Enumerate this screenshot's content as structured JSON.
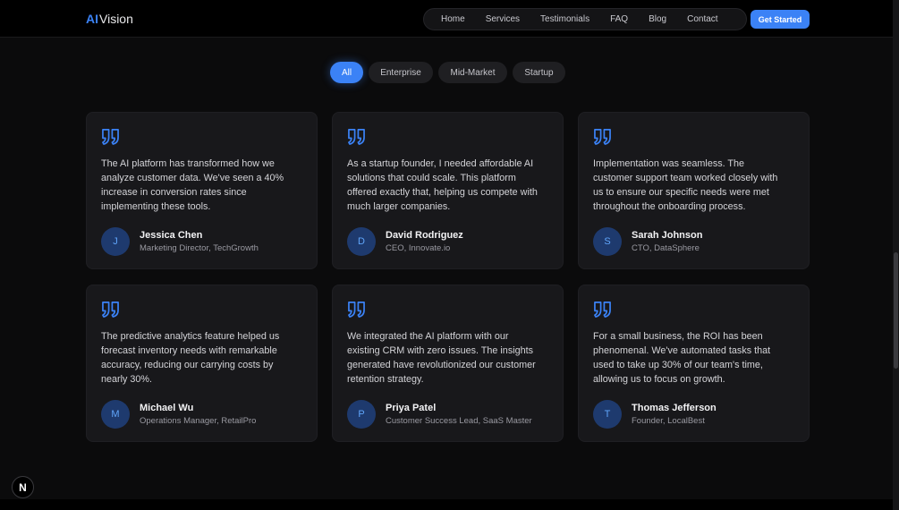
{
  "header": {
    "logo_ai": "AI",
    "logo_rest": "Vision",
    "nav": [
      "Home",
      "Services",
      "Testimonials",
      "FAQ",
      "Blog",
      "Contact"
    ],
    "cta": "Get Started"
  },
  "filters": [
    "All",
    "Enterprise",
    "Mid-Market",
    "Startup"
  ],
  "active_filter": "All",
  "testimonials": [
    {
      "quote": "The AI platform has transformed how we analyze customer data. We've seen a 40% increase in conversion rates since implementing these tools.",
      "initial": "J",
      "name": "Jessica Chen",
      "role": "Marketing Director, TechGrowth"
    },
    {
      "quote": "As a startup founder, I needed affordable AI solutions that could scale. This platform offered exactly that, helping us compete with much larger companies.",
      "initial": "D",
      "name": "David Rodriguez",
      "role": "CEO, Innovate.io"
    },
    {
      "quote": "Implementation was seamless. The customer support team worked closely with us to ensure our specific needs were met throughout the onboarding process.",
      "initial": "S",
      "name": "Sarah Johnson",
      "role": "CTO, DataSphere"
    },
    {
      "quote": "The predictive analytics feature helped us forecast inventory needs with remarkable accuracy, reducing our carrying costs by nearly 30%.",
      "initial": "M",
      "name": "Michael Wu",
      "role": "Operations Manager, RetailPro"
    },
    {
      "quote": "We integrated the AI platform with our existing CRM with zero issues. The insights generated have revolutionized our customer retention strategy.",
      "initial": "P",
      "name": "Priya Patel",
      "role": "Customer Success Lead, SaaS Master"
    },
    {
      "quote": "For a small business, the ROI has been phenomenal. We've automated tasks that used to take up 30% of our team's time, allowing us to focus on growth.",
      "initial": "T",
      "name": "Thomas Jefferson",
      "role": "Founder, LocalBest"
    }
  ],
  "dev_badge": "N",
  "colors": {
    "accent": "#3b82f6",
    "card_bg": "#18181b",
    "avatar_bg": "#1e3a6e"
  }
}
